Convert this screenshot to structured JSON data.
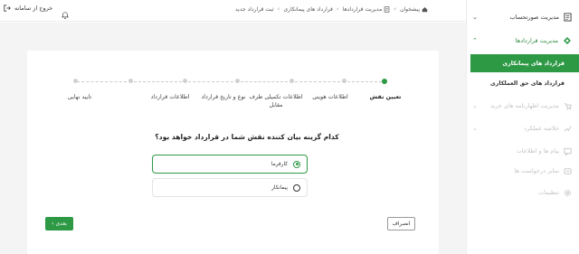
{
  "header": {
    "logout_label": "خروج از سامانه",
    "breadcrumb": [
      "پیشخوان",
      "مدیریت قراردادها",
      "قرارداد های پیمانکاری",
      "ثبت قرارداد جدید"
    ]
  },
  "sidebar": {
    "items": [
      {
        "label": "مدیریت صورتحساب",
        "icon": "invoice-icon",
        "state": "normal"
      },
      {
        "label": "مدیریت قراردادها",
        "icon": "contract-icon",
        "state": "open"
      },
      {
        "label": "قرارداد های پیمانکاری",
        "state": "selected"
      },
      {
        "label": "قرارداد های حق العملکاری",
        "state": "sub"
      },
      {
        "label": "مدیریت اظهارنامه های خرید",
        "icon": "purchase-icon",
        "state": "disabled"
      },
      {
        "label": "خلاصه عملکرد",
        "icon": "performance-icon",
        "state": "disabled"
      },
      {
        "label": "پیام ها و اطلاعات",
        "icon": "message-icon",
        "state": "disabled"
      },
      {
        "label": "سایر درخواست ها",
        "icon": "request-icon",
        "state": "disabled"
      },
      {
        "label": "تنظیمات",
        "icon": "settings-icon",
        "state": "disabled"
      }
    ]
  },
  "stepper": {
    "steps": [
      "تعیین نقش",
      "اطلاعات هویتی",
      "اطلاعات تکمیلی طرف مقابل",
      "نوع و تاریخ قرارداد",
      "اطلاعات قرارداد",
      "تایید نهایی"
    ],
    "active_index": 0
  },
  "form": {
    "question": "کدام گزینه بیان کننده نقش شما در قرارداد خواهد بود؟",
    "options": [
      {
        "label": "کارفرما",
        "selected": true
      },
      {
        "label": "پیمانکار",
        "selected": false
      }
    ]
  },
  "actions": {
    "next_label": "بعدی",
    "cancel_label": "انصراف"
  },
  "colors": {
    "accent": "#2e9945",
    "muted": "#c4c4c4"
  }
}
